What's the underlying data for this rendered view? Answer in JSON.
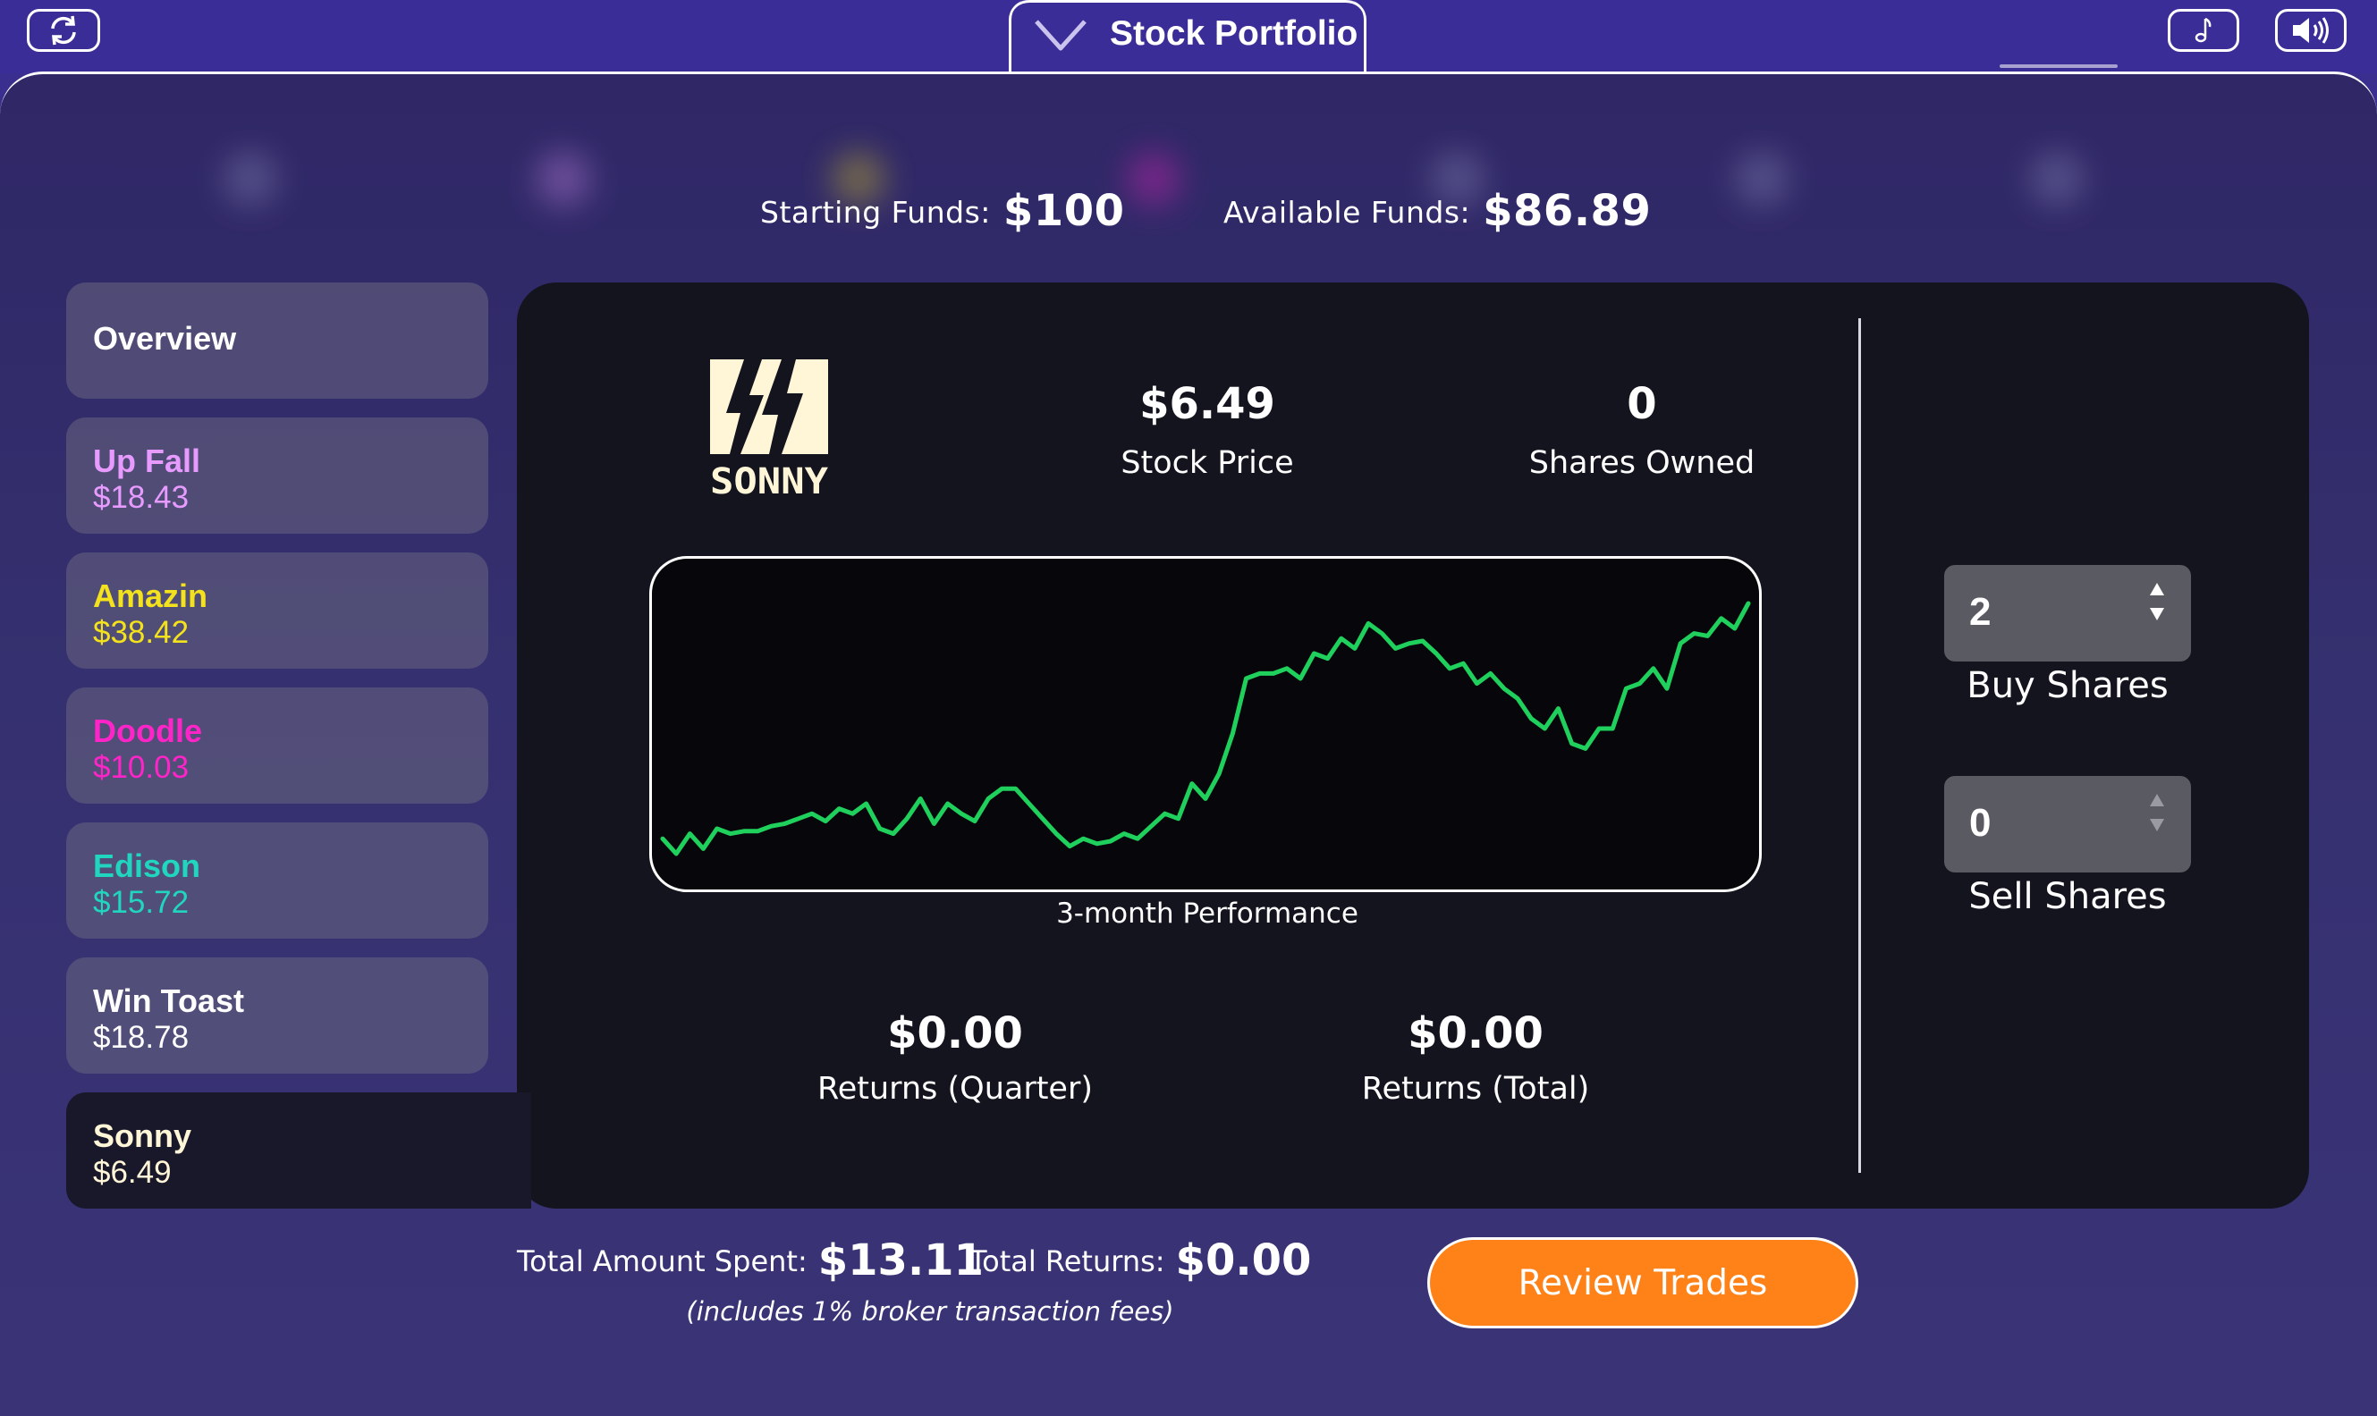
{
  "header": {
    "title": "Stock Portfolio",
    "icons": [
      "refresh-icon",
      "chevron-down-icon",
      "music-note-icon",
      "speaker-icon"
    ]
  },
  "funds": {
    "starting_label": "Starting Funds:",
    "starting_value": "$100",
    "available_label": "Available Funds:",
    "available_value": "$86.89"
  },
  "sidebar": {
    "items": [
      {
        "name": "Overview",
        "price": "",
        "color": "#ffffff"
      },
      {
        "name": "Up Fall",
        "price": "$18.43",
        "color": "#e79bff"
      },
      {
        "name": "Amazin",
        "price": "$38.42",
        "color": "#f4e21c"
      },
      {
        "name": "Doodle",
        "price": "$10.03",
        "color": "#ff24c8"
      },
      {
        "name": "Edison",
        "price": "$15.72",
        "color": "#21d6bf"
      },
      {
        "name": "Win Toast",
        "price": "$18.78",
        "color": "#ffffff"
      },
      {
        "name": "Sonny",
        "price": "$6.49",
        "color": "#fff6d8"
      }
    ]
  },
  "stock": {
    "logo_text": "SONNY",
    "logo_color": "#fff6d8",
    "price_value": "$6.49",
    "price_label": "Stock Price",
    "shares_value": "0",
    "shares_label": "Shares Owned",
    "chart_caption": "3-month Performance",
    "returns_quarter_value": "$0.00",
    "returns_quarter_label": "Returns (Quarter)",
    "returns_total_value": "$0.00",
    "returns_total_label": "Returns (Total)"
  },
  "trade": {
    "buy_value": "2",
    "buy_label": "Buy Shares",
    "sell_value": "0",
    "sell_label": "Sell Shares"
  },
  "totals": {
    "spent_label": "Total Amount Spent:",
    "spent_value": "$13.11",
    "returns_label": "Total Returns:",
    "returns_value": "$0.00",
    "fee_note": "(includes 1% broker transaction fees)",
    "review_button": "Review Trades"
  },
  "colors": {
    "accent_orange": "#ff8219",
    "line_green": "#1fd15c",
    "header_purple": "#3b2d97"
  },
  "chart_data": {
    "type": "line",
    "title": "3-month Performance",
    "xlabel": "",
    "ylabel": "",
    "grid": false,
    "values": [
      3.2,
      2.9,
      3.3,
      3.0,
      3.4,
      3.3,
      3.35,
      3.35,
      3.45,
      3.5,
      3.6,
      3.7,
      3.55,
      3.8,
      3.7,
      3.9,
      3.4,
      3.3,
      3.6,
      4.0,
      3.5,
      3.9,
      3.7,
      3.55,
      4.0,
      4.2,
      4.2,
      3.9,
      3.6,
      3.3,
      3.05,
      3.2,
      3.1,
      3.15,
      3.3,
      3.2,
      3.45,
      3.7,
      3.6,
      4.3,
      4.0,
      4.5,
      5.3,
      6.4,
      6.5,
      6.5,
      6.6,
      6.4,
      6.9,
      6.8,
      7.2,
      7.0,
      7.5,
      7.3,
      7.0,
      7.1,
      7.15,
      6.9,
      6.6,
      6.7,
      6.3,
      6.5,
      6.2,
      6.0,
      5.6,
      5.4,
      5.8,
      5.1,
      5.0,
      5.4,
      5.4,
      6.2,
      6.3,
      6.6,
      6.2,
      7.1,
      7.3,
      7.25,
      7.6,
      7.4,
      7.9
    ]
  }
}
